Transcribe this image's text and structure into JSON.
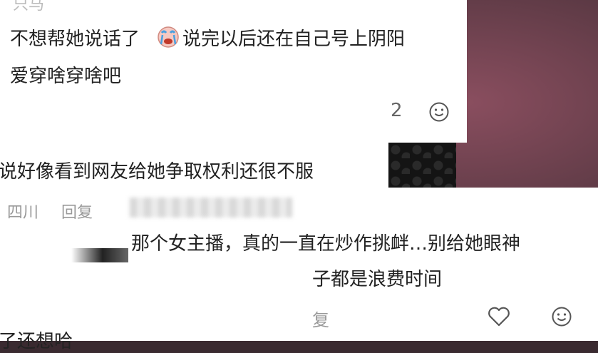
{
  "top_comment": {
    "username_partial": "只马",
    "text_line1_a": "不想帮她说话了",
    "text_line1_b": "说完以后还在自己号上阴阳",
    "text_line2": "爱穿啥穿啥吧",
    "like_count": "2"
  },
  "middle_comment": {
    "text": "说好像看到网友给她争取权利还很不服",
    "location": "四川",
    "reply_label": "回复"
  },
  "front_comment": {
    "text_line1": "那个女主播，真的一直在炒作挑衅…别给她眼神",
    "text_line2": "子都是浪费时间",
    "reply_label_partial": "复"
  },
  "bottom_partial": {
    "text": "了还想哈"
  },
  "icons": [
    "crying-emoji-icon",
    "smile-icon",
    "heart-icon"
  ]
}
